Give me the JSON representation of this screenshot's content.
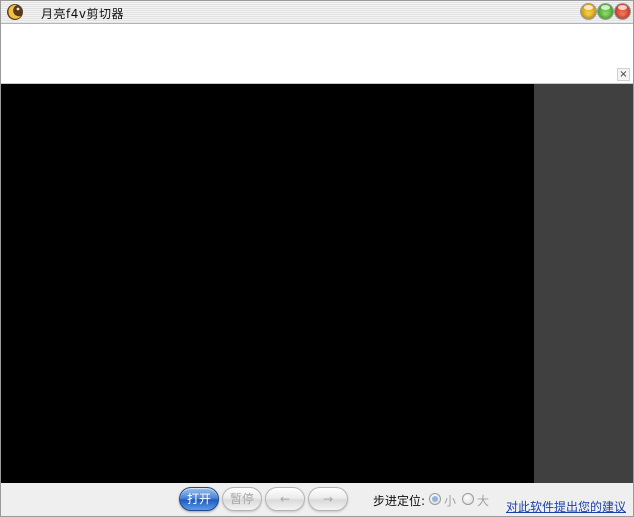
{
  "window": {
    "title": "月亮f4v剪切器",
    "icon": "moon-icon"
  },
  "banner": {
    "close_glyph": "×"
  },
  "controls": {
    "open_label": "打开",
    "pause_label": "暂停",
    "prev_label": "←",
    "next_label": "→"
  },
  "step": {
    "label": "步进定位:",
    "options": [
      {
        "label": "小",
        "selected": true
      },
      {
        "label": "大",
        "selected": false
      }
    ]
  },
  "feedback": {
    "link_text": "对此软件提出您的建议"
  },
  "colors": {
    "accent": "#1f5cc0",
    "video_bg": "#000000",
    "side_panel": "#404040",
    "link": "#1a3fa8"
  }
}
